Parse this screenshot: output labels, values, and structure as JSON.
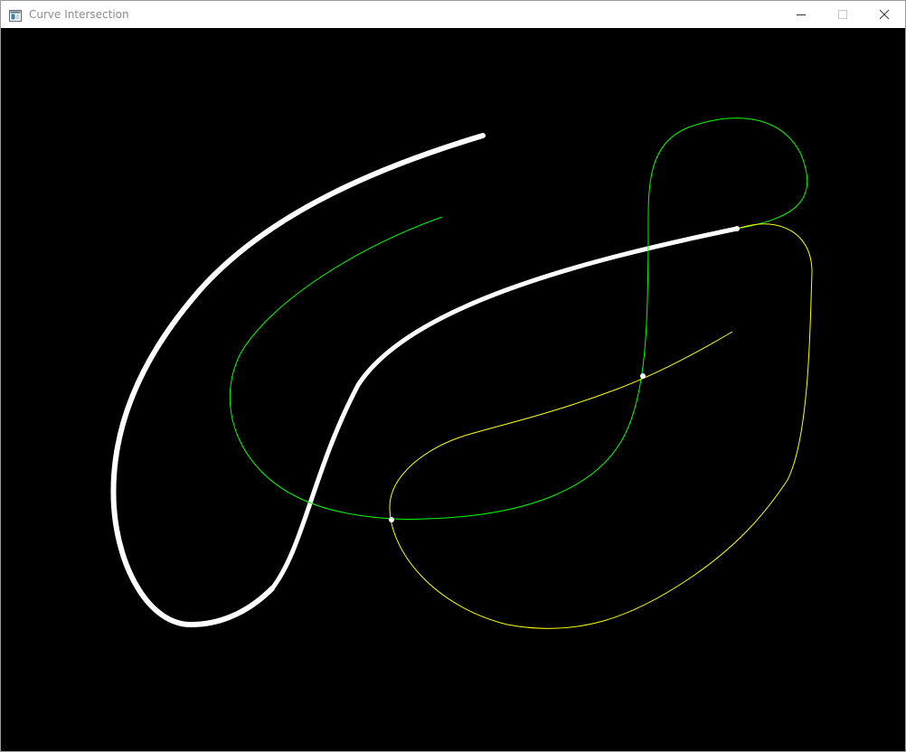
{
  "window": {
    "title": "Curve Intersection"
  },
  "icons": {
    "app": "app-window-icon",
    "minimize": "minimize-icon",
    "maximize": "maximize-icon",
    "close": "close-icon"
  },
  "colors": {
    "canvas_background": "#000000",
    "thick_curves": "#ffffff",
    "green_curve": "#00ff00",
    "yellow_curve": "#ffff00",
    "intersection_points": "#ffffff"
  }
}
